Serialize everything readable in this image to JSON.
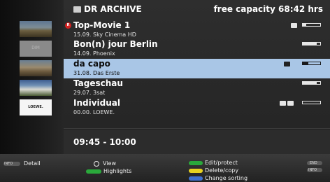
{
  "header": {
    "title": "DR ARCHIVE",
    "capacity": "free capacity 68:42 hrs",
    "icon": "archive-icon"
  },
  "recordings": [
    {
      "title": "Top-Movie 1",
      "subtitle": "15.09.   Sky Cinema HD",
      "recording_icon": true,
      "selected": false,
      "progress": 0.2,
      "badges": [
        "info-icon"
      ]
    },
    {
      "title": "Bon(n) jour Berlin",
      "subtitle": "14.09.   Phoenix",
      "selected": false,
      "progress": 0.8,
      "badges": []
    },
    {
      "title": "da capo",
      "subtitle": "31.08.   Das Erste",
      "selected": true,
      "progress": 0.3,
      "badges": [
        "play-icon"
      ]
    },
    {
      "title": "Tageschau",
      "subtitle": "29.07.   3sat",
      "selected": false,
      "progress": 0.8,
      "badges": []
    },
    {
      "title": "Individual",
      "subtitle": "00.00.   LOEWE.",
      "selected": false,
      "progress": 0.0,
      "badges": [
        "protect-icon",
        "copy-icon"
      ]
    }
  ],
  "thumbnails": [
    "landscape",
    "dim",
    "landscape",
    "city",
    "loewe-logo"
  ],
  "thumb_text": {
    "dim": "DIM",
    "logo": "LOEWE."
  },
  "time_range": "09:45 - 10:00",
  "footer": {
    "detail_key": "INFO",
    "detail_label": "Detail",
    "view_label": "View",
    "highlights_label": "Highlights",
    "edit_label": "Edit/protect",
    "delete_label": "Delete/copy",
    "sorting_label": "Change sorting",
    "end_key_1": "END",
    "end_key_2": "INFO"
  },
  "colors": {
    "selection": "#a9c6e6",
    "green": "#2aa93b",
    "yellow": "#e7d221",
    "blue": "#3e6fd0",
    "red": "#d42121"
  }
}
